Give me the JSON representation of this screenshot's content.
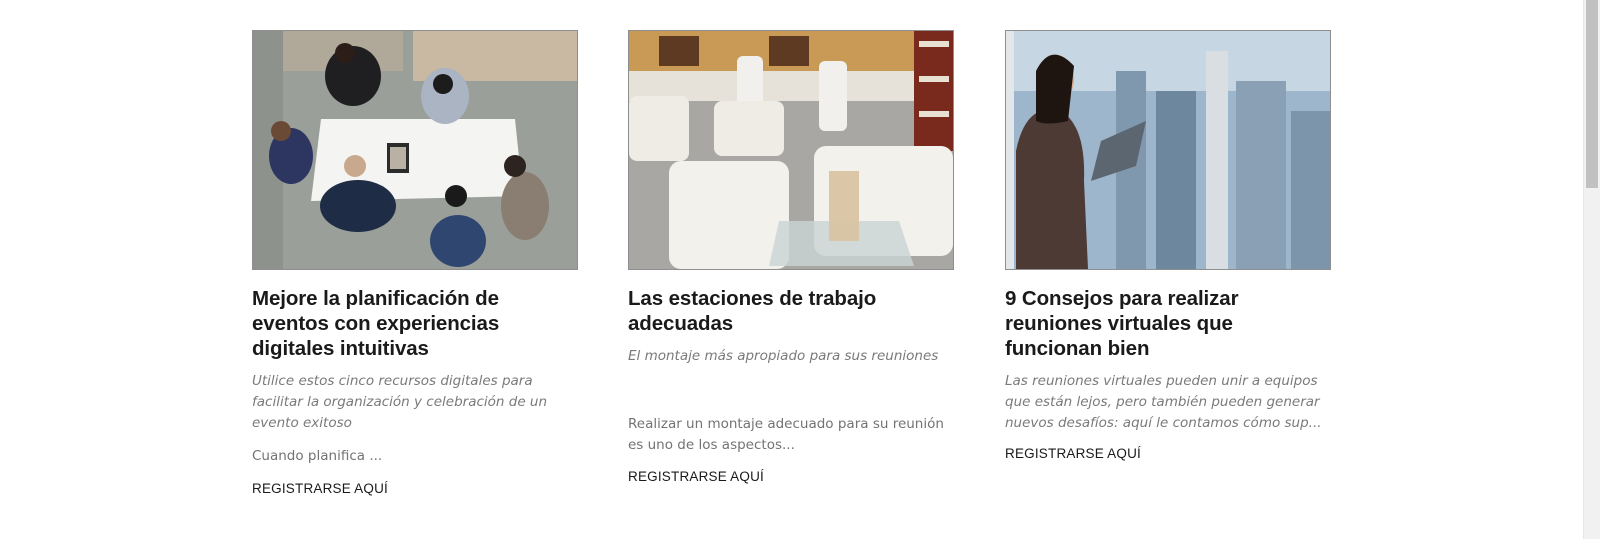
{
  "cards": [
    {
      "image_alt": "Personas alrededor de una mesa blanca usando una tableta",
      "title": "Mejore la planificación de eventos con experiencias digitales intuitivas",
      "subtitle": "Utilice estos cinco recursos digitales para facilitar la organización y celebración de un evento exitoso",
      "body": "Cuando planifica ...",
      "cta": "REGISTRARSE AQUÍ"
    },
    {
      "image_alt": "Salón con sofás blancos y mesas altas",
      "title": "Las estaciones de trabajo adecuadas",
      "subtitle": "El montaje más apropiado para sus reuniones",
      "body": "Realizar un montaje adecuado para su reunión es uno de los aspectos...",
      "cta": "REGISTRARSE AQUÍ"
    },
    {
      "image_alt": "Mujer con tableta junto a una ventana con vista a la ciudad",
      "title": "9 Consejos para realizar reuniones virtuales que funcionan bien",
      "subtitle": "Las reuniones virtuales pueden unir a equipos que están lejos, pero también pueden generar nuevos desafíos: aquí le contamos cómo sup...",
      "body": "",
      "cta": "REGISTRARSE AQUÍ"
    }
  ],
  "colors": {
    "title": "#1a1a1a",
    "subtitle": "#7a7a7a",
    "body": "#737373",
    "cta": "#1a1a1a",
    "image_border": "#8e8e8e"
  }
}
